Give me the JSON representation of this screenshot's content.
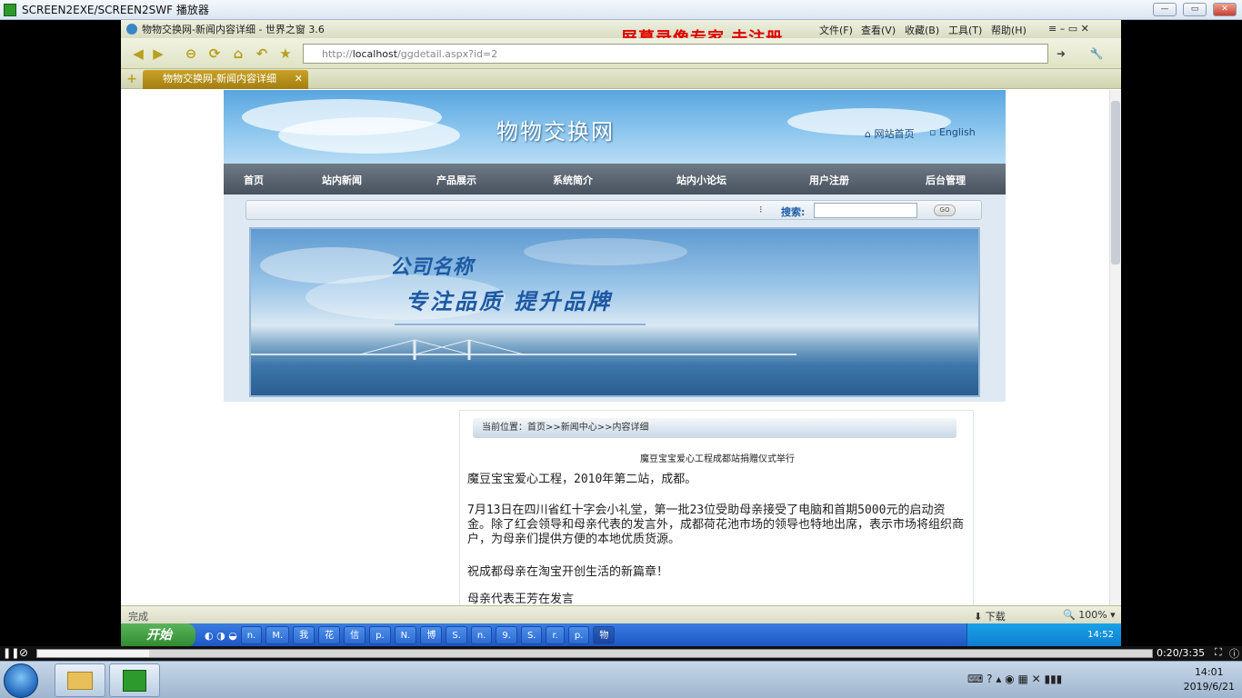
{
  "player": {
    "title": "SCREEN2EXE/SCREEN2SWF 播放器",
    "time": "0:20/3:35",
    "progress": 0.1
  },
  "browser": {
    "title": "物物交换网-新闻内容详细 - 世界之窗 3.6",
    "menu": [
      "文件(F)",
      "查看(V)",
      "收藏(B)",
      "工具(T)",
      "帮助(H)"
    ],
    "url_prefix": "http://",
    "url_host": "localhost",
    "url_path": "/ggdetail.aspx?id=2",
    "tab_label": "物物交换网-新闻内容详细",
    "status": "完成",
    "download_label": "下载",
    "zoom": "100%"
  },
  "watermark": "屏幕录像专家  未注册",
  "site": {
    "title": "物物交换网",
    "home_link": "网站首页",
    "english_link": "English",
    "nav": [
      "首页",
      "站内新闻",
      "产品展示",
      "系统简介",
      "站内小论坛",
      "用户注册",
      "后台管理"
    ],
    "search_label": "搜索:",
    "search_button": "GO",
    "banner_company": "公司名称",
    "banner_slogan": "专注品质  提升品牌",
    "breadcrumb": "当前位置：首页>>新闻中心>>内容详细",
    "article_title": "魔豆宝宝爱心工程成都站捐赠仪式举行",
    "paragraphs": [
      "魔豆宝宝爱心工程，2010年第二站，成都。",
      "7月13日在四川省红十字会小礼堂，第一批23位受助母亲接受了电脑和首期5000元的启动资金。除了红会领导和母亲代表的发言外，成都荷花池市场的领导也特地出席，表示市场将组织商户，为母亲们提供方便的本地优质货源。",
      "祝成都母亲在淘宝开创生活的新篇章！",
      "母亲代表王芳在发言"
    ]
  },
  "xp_taskbar": {
    "start": "开始",
    "buttons": [
      "n.",
      "M.",
      "我",
      "花",
      "信",
      "p.",
      "N.",
      "博",
      "S.",
      "n.",
      "9.",
      "S.",
      "r.",
      "p.",
      "物"
    ],
    "tray_time": "14:52"
  },
  "win7": {
    "time": "14:01",
    "date": "2019/6/21"
  }
}
